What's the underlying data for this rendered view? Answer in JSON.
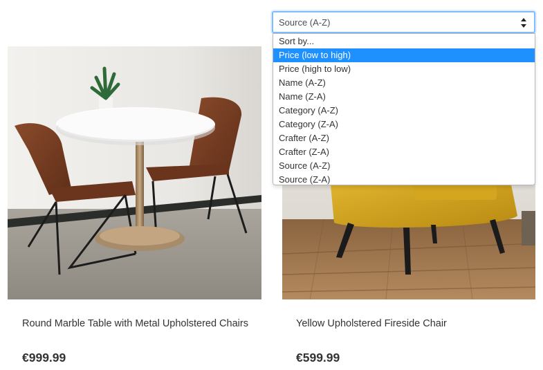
{
  "sort": {
    "selected_label": "Source (A-Z)",
    "options": [
      "Sort by...",
      "Price (low to high)",
      "Price (high to low)",
      "Name (A-Z)",
      "Name (Z-A)",
      "Category (A-Z)",
      "Category (Z-A)",
      "Crafter (A-Z)",
      "Crafter (Z-A)",
      "Source (A-Z)",
      "Source (Z-A)"
    ],
    "highlighted_option": "Price (low to high)"
  },
  "products": [
    {
      "title": "Round Marble Table with Metal Upholstered Chairs",
      "price": "€999.99"
    },
    {
      "title": "Yellow Upholstered Fireside Chair",
      "price": "€599.99"
    }
  ],
  "colors": {
    "highlight": "#1e90ff",
    "select_border": "#80bdff",
    "text": "#333333"
  }
}
